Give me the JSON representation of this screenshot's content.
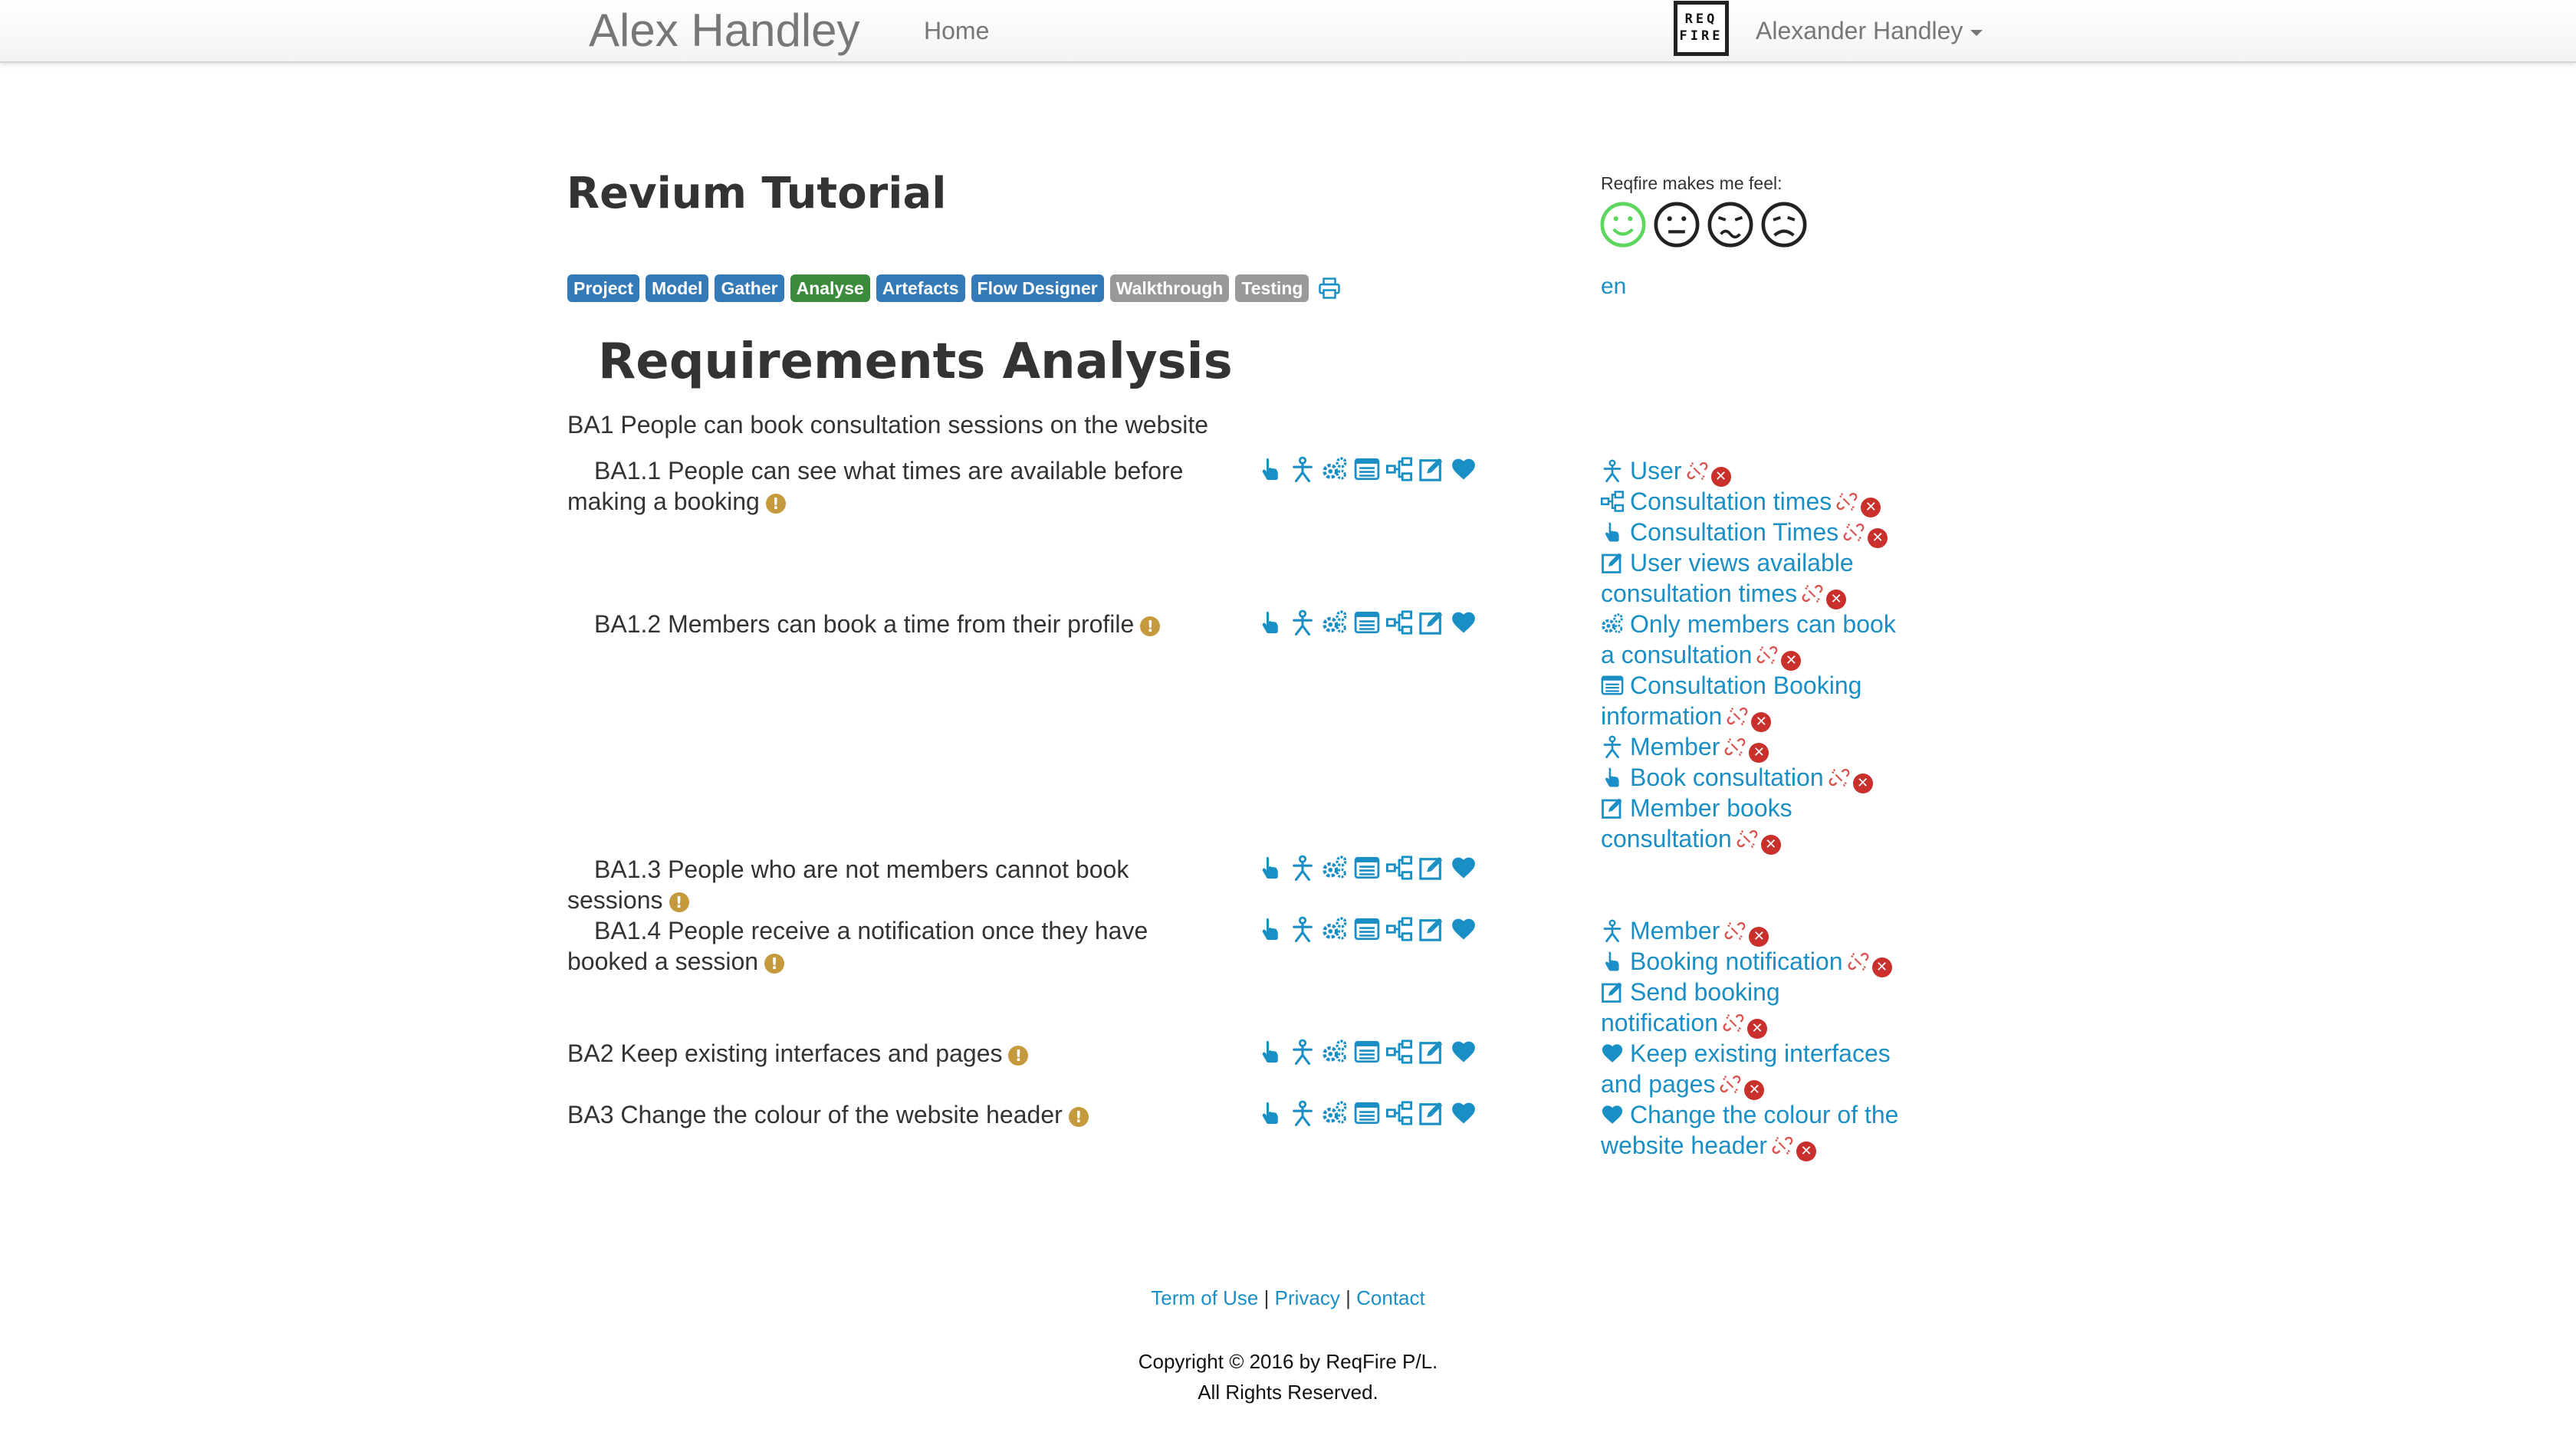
{
  "navbar": {
    "brand": "Alex Handley",
    "home": "Home",
    "user": "Alexander Handley",
    "logo_top": "REQ",
    "logo_bottom": "FIRE"
  },
  "project_title": "Revium Tutorial",
  "tabs": [
    {
      "label": "Project",
      "style": "blue"
    },
    {
      "label": "Model",
      "style": "blue"
    },
    {
      "label": "Gather",
      "style": "blue"
    },
    {
      "label": "Analyse",
      "style": "green"
    },
    {
      "label": "Artefacts",
      "style": "blue"
    },
    {
      "label": "Flow Designer",
      "style": "blue"
    },
    {
      "label": "Walkthrough",
      "style": "grey"
    },
    {
      "label": "Testing",
      "style": "grey"
    }
  ],
  "feedback": {
    "label": "Reqfire makes me feel:",
    "faces": [
      "happy",
      "neutral",
      "worried",
      "sad"
    ],
    "selected": "happy"
  },
  "language": "en",
  "section_title": "Requirements Analysis",
  "requirements": [
    {
      "id": "BA1",
      "line1": "BA1 People can book consultation sessions on the website",
      "line2": "",
      "warn": false,
      "icons": false
    },
    {
      "id": "BA1.1",
      "line1": "    BA1.1 People can see what times are available before",
      "line2": "making a booking",
      "warn": true,
      "icons": true
    },
    {
      "id": "BA1.2",
      "line1": "    BA1.2 Members can book a time from their profile",
      "line2": "",
      "warn": true,
      "icons": true
    },
    {
      "id": "BA1.3",
      "line1": "    BA1.3 People who are not members cannot book",
      "line2": "sessions",
      "warn": true,
      "icons": true
    },
    {
      "id": "BA1.4",
      "line1": "    BA1.4 People receive a notification once they have",
      "line2": "booked a session",
      "warn": true,
      "icons": true
    },
    {
      "id": "BA2",
      "line1": "BA2 Keep existing interfaces and pages",
      "line2": "",
      "warn": true,
      "icons": true
    },
    {
      "id": "BA3",
      "line1": "BA3 Change the colour of the website header",
      "line2": "",
      "warn": true,
      "icons": true
    }
  ],
  "linked_items": [
    {
      "icon": "actor",
      "lines": [
        "User"
      ]
    },
    {
      "icon": "flow",
      "lines": [
        "Consultation times"
      ]
    },
    {
      "icon": "touch",
      "lines": [
        "Consultation Times"
      ]
    },
    {
      "icon": "edit",
      "lines": [
        "User views available",
        "consultation times"
      ]
    },
    {
      "icon": "gears",
      "lines": [
        "Only members can book",
        "a consultation"
      ]
    },
    {
      "icon": "list",
      "lines": [
        "Consultation Booking",
        "information"
      ]
    },
    {
      "icon": "actor",
      "lines": [
        "Member"
      ]
    },
    {
      "icon": "touch",
      "lines": [
        "Book consultation"
      ]
    },
    {
      "icon": "edit",
      "lines": [
        "Member books",
        "consultation"
      ]
    },
    {
      "icon": "actor",
      "lines": [
        "Member"
      ]
    },
    {
      "icon": "touch",
      "lines": [
        "Booking notification"
      ]
    },
    {
      "icon": "edit",
      "lines": [
        "Send booking",
        "notification"
      ]
    },
    {
      "icon": "heart",
      "lines": [
        "Keep existing interfaces",
        "and pages"
      ]
    },
    {
      "icon": "heart",
      "lines": [
        "Change the colour of the",
        "website header"
      ]
    }
  ],
  "footer": {
    "terms": "Term of Use",
    "privacy": "Privacy",
    "contact": "Contact",
    "separator": "|",
    "copyright1": "Copyright © 2016 by ReqFire P/L.",
    "copyright2": "All Rights Reserved."
  },
  "colors": {
    "link": "#1a8fc6",
    "tab_blue": "#337ab7",
    "tab_green": "#3c8a3c",
    "tab_grey": "#999999",
    "warn": "#c49a3c",
    "delete": "#c9302c",
    "happy": "#5cd65c"
  }
}
